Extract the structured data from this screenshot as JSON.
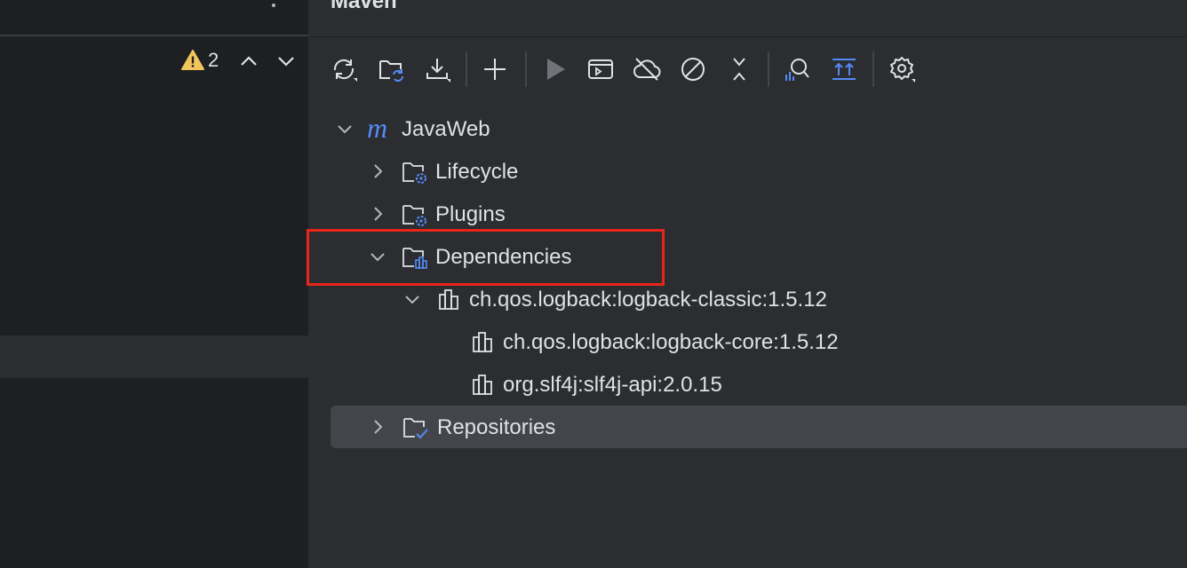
{
  "editor": {
    "warning_count": "2",
    "icons": [
      "more-vertical-icon",
      "warning-icon",
      "chevron-up-icon",
      "chevron-down-icon"
    ]
  },
  "maven": {
    "title": "Maven",
    "toolbar": [
      {
        "name": "reload-all-projects",
        "icon": "sync-icon"
      },
      {
        "name": "generate-sources",
        "icon": "folder-refresh-icon"
      },
      {
        "name": "download-sources",
        "icon": "download-icon"
      },
      {
        "name": "add-maven-projects",
        "icon": "plus-icon"
      },
      {
        "name": "run-maven-build",
        "icon": "play-icon"
      },
      {
        "name": "execute-maven-goal",
        "icon": "terminal-icon"
      },
      {
        "name": "toggle-offline-mode",
        "icon": "cloud-off-icon"
      },
      {
        "name": "skip-tests",
        "icon": "slash-circle-icon"
      },
      {
        "name": "collapse-all",
        "icon": "collapse-icon"
      },
      {
        "name": "analyze-dependencies",
        "icon": "analyze-icon"
      },
      {
        "name": "show-dependencies",
        "icon": "expand-up-icon"
      },
      {
        "name": "maven-settings",
        "icon": "gear-icon"
      }
    ],
    "tree": {
      "project": "JavaWeb",
      "lifecycle": "Lifecycle",
      "plugins": "Plugins",
      "dependencies": "Dependencies",
      "dep_logback_classic": "ch.qos.logback:logback-classic:1.5.12",
      "dep_logback_core": "ch.qos.logback:logback-core:1.5.12",
      "dep_slf4j": "org.slf4j:slf4j-api:2.0.15",
      "repositories": "Repositories"
    }
  },
  "colors": {
    "background": "#1e1f22",
    "panel": "#2b2d30",
    "accent": "#548af7",
    "warning": "#f2c55c",
    "highlight_box": "#e8251a"
  }
}
